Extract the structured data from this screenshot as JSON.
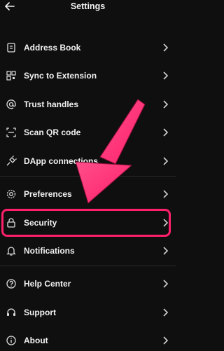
{
  "header": {
    "title": "Settings",
    "back_icon": "arrow-left-icon"
  },
  "menu": [
    {
      "label": "Address Book",
      "icon": "address-book-icon"
    },
    {
      "label": "Sync to Extension",
      "icon": "qr-sync-icon"
    },
    {
      "label": "Trust handles",
      "icon": "at-sign-icon"
    },
    {
      "label": "Scan QR code",
      "icon": "scan-qr-icon"
    },
    {
      "label": "DApp connections",
      "icon": "plug-icon"
    },
    {
      "label": "Preferences",
      "icon": "gear-icon"
    },
    {
      "label": "Security",
      "icon": "lock-icon"
    },
    {
      "label": "Notifications",
      "icon": "bell-icon"
    },
    {
      "label": "Help Center",
      "icon": "help-icon"
    },
    {
      "label": "Support",
      "icon": "headset-icon"
    },
    {
      "label": "About",
      "icon": "info-icon"
    }
  ],
  "annotation": {
    "highlight_color": "#ff1f6a",
    "arrow_color": "#ff1f6a"
  }
}
